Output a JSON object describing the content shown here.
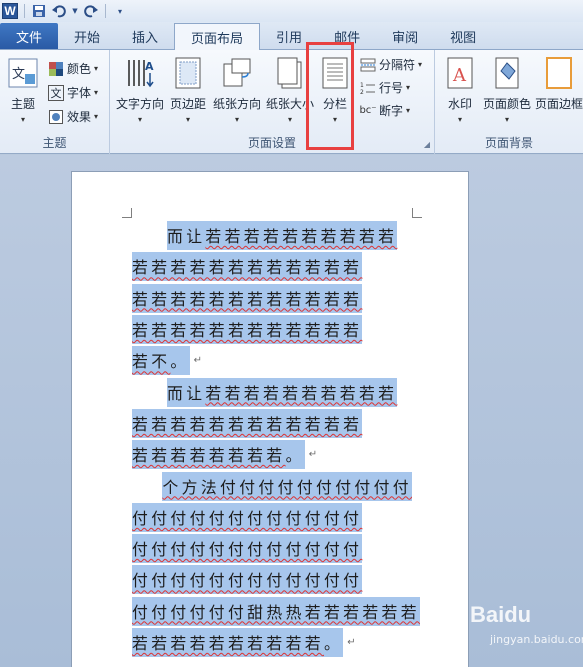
{
  "quick_access": {
    "logo": "W",
    "icons": [
      "save-icon",
      "undo-icon",
      "redo-icon",
      "customize-icon"
    ]
  },
  "tabs": [
    "文件",
    "开始",
    "插入",
    "页面布局",
    "引用",
    "邮件",
    "审阅",
    "视图"
  ],
  "active_tab": "页面布局",
  "ribbon": {
    "theme_group": {
      "label": "主题",
      "themes": "主题",
      "colors": "颜色",
      "fonts": "字体",
      "effects": "效果"
    },
    "page_setup_group": {
      "label": "页面设置",
      "text_direction": "文字方向",
      "margins": "页边距",
      "orientation": "纸张方向",
      "size": "纸张大小",
      "columns": "分栏",
      "breaks": "分隔符",
      "line_numbers": "行号",
      "hyphenation": "断字"
    },
    "page_background_group": {
      "label": "页面背景",
      "watermark": "水印",
      "page_color": "页面颜色",
      "page_borders": "页面边框"
    }
  },
  "document": {
    "lines": [
      {
        "indent": true,
        "plain": "而让",
        "wavy": "若若若若若若若若若若",
        "tail": "",
        "pmark": false
      },
      {
        "indent": false,
        "plain": "",
        "wavy": "若若若若若若若若若若若若",
        "tail": "",
        "pmark": false
      },
      {
        "indent": false,
        "plain": "",
        "wavy": "若若若若若若若若若若若若",
        "tail": "",
        "pmark": false
      },
      {
        "indent": false,
        "plain": "",
        "wavy": "若若若若若若若若若若若若",
        "tail": "",
        "pmark": false
      },
      {
        "indent": false,
        "plain": "",
        "wavy": "若不",
        "tail": "。",
        "pmark": true
      },
      {
        "indent": true,
        "plain": "而让",
        "wavy": "若若若若若若若若若若",
        "tail": "",
        "pmark": false
      },
      {
        "indent": false,
        "plain": "",
        "wavy": "若若若若若若若若若若若若",
        "tail": "",
        "pmark": false
      },
      {
        "indent": false,
        "plain": "",
        "wavy": "若若若若若若若若",
        "tail": "。",
        "pmark": true
      },
      {
        "indent": true,
        "plain": "",
        "wavy": "个方法付付付付付付付付付付",
        "tail": "",
        "pmark": false
      },
      {
        "indent": false,
        "plain": "",
        "wavy": "付付付付付付付付付付付付",
        "tail": "",
        "pmark": false
      },
      {
        "indent": false,
        "plain": "",
        "wavy": "付付付付付付付付付付付付",
        "tail": "",
        "pmark": false
      },
      {
        "indent": false,
        "plain": "",
        "wavy": "付付付付付付付付付付付付",
        "tail": "",
        "pmark": false
      },
      {
        "indent": false,
        "plain": "",
        "wavy": "付付付付付付甜热热若若若若若若",
        "tail": "",
        "pmark": false
      },
      {
        "indent": false,
        "plain": "",
        "wavy": "若若若若若若若若若若",
        "tail": "。",
        "pmark": true
      }
    ]
  },
  "watermark": {
    "brand": "Baidu",
    "sub": "jingyan.baidu.com"
  },
  "colors": {
    "selection": "#a7c6ec",
    "highlight_box": "#e84040",
    "file_tab": "#2a5aa5"
  }
}
